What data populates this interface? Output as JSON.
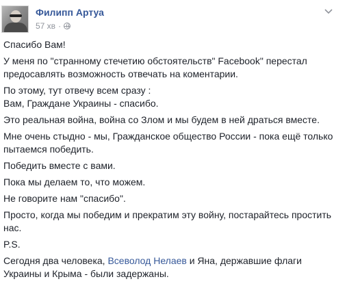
{
  "post": {
    "author": "Филипп Артуа",
    "time": "57 хв",
    "separator": "·",
    "icons": {
      "privacy": "globe-icon",
      "menu": "chevron-down-icon"
    },
    "paragraphs": {
      "p1": "Спасибо Вам!",
      "p2a": "У меня по \"странному стечетию обстоятельств\" Facebook\" перестал",
      "p2b": "предосавлять возможность отвечать на коментарии.",
      "p3a": "По этому, тут отвечу всем сразу :",
      "p3b": "Вам, Граждане Украины - спасибо.",
      "p4": "Это реальная война, война со Злом и мы будем в ней драться вместе.",
      "p5a": "Мне очень стыдно - мы, Гражданское общество России - пока ещё только",
      "p5b": "пытаемся победить.",
      "p6": "Победить вместе с вами.",
      "p7": "Пока мы делаем то, что можем.",
      "p8": "Не говорите нам \"спасибо\".",
      "p9a": "Просто, когда мы победим и прекратим эту войну, постарайтесь простить",
      "p9b": "нас.",
      "p10": "P.S.",
      "p11_before": "Сегодня два человека, ",
      "p11_link": "Всеволод Нелаев",
      "p11_after": " и Яна, державшие флаги",
      "p11b": "Украины и Крыма - были задержаны."
    },
    "colors": {
      "link": "#365899",
      "text": "#1d2129",
      "meta": "#90949c"
    }
  }
}
